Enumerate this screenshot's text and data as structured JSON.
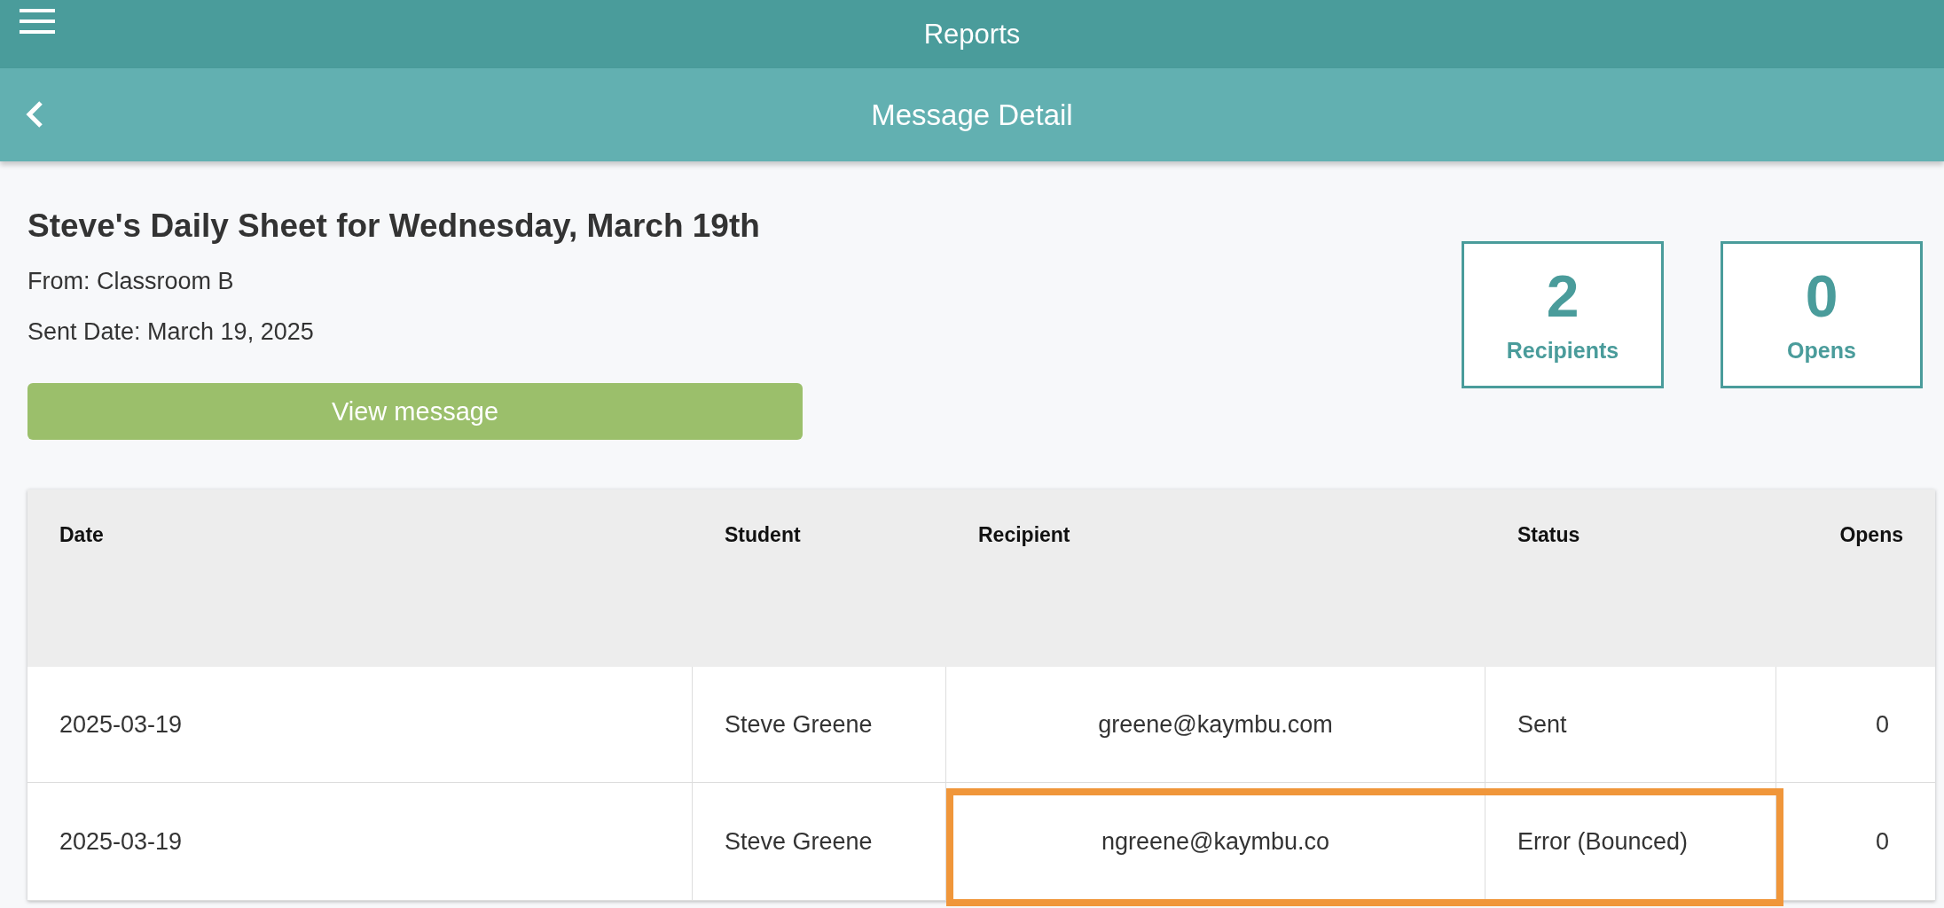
{
  "top_bar": {
    "title": "Reports"
  },
  "sub_bar": {
    "title": "Message Detail"
  },
  "message": {
    "title": "Steve's Daily Sheet for Wednesday, March 19th",
    "from": "From: Classroom B",
    "sent_date": "Sent Date: March 19, 2025",
    "button": "View message"
  },
  "stats": [
    {
      "value": "2",
      "label": "Recipients"
    },
    {
      "value": "0",
      "label": "Opens"
    }
  ],
  "table": {
    "columns": [
      "Date",
      "Student",
      "Recipient",
      "Status",
      "Opens"
    ],
    "rows": [
      {
        "cells": [
          "2025-03-19",
          "Steve Greene",
          "greene@kaymbu.com",
          "Sent",
          "0"
        ],
        "highlighted": false
      },
      {
        "cells": [
          "2025-03-19",
          "Steve Greene",
          "ngreene@kaymbu.co",
          "Error (Bounced)",
          "0"
        ],
        "highlighted": true
      }
    ]
  }
}
